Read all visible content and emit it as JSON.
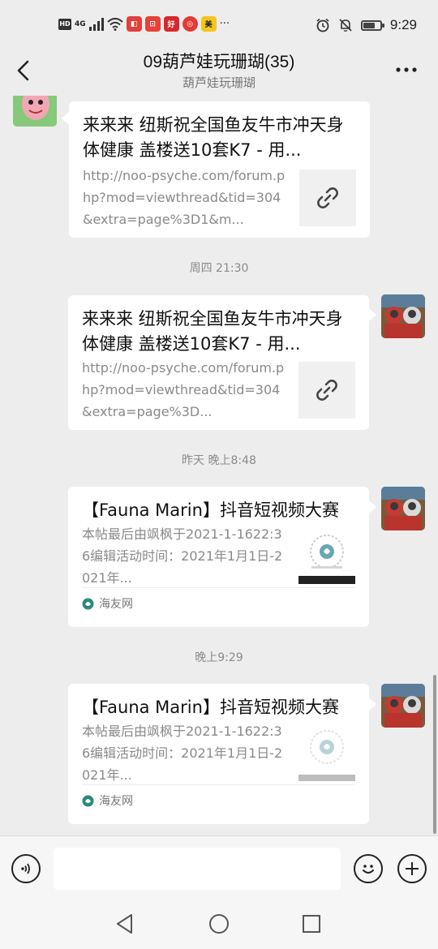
{
  "status_bar": {
    "network_type": "4G",
    "hd_label": "HD",
    "app_badge_1": "◧",
    "app_badge_2": "⊡",
    "app_badge_3": "好",
    "app_badge_4": "◎",
    "app_badge_5": "美",
    "overflow": "···",
    "time": "9:29",
    "battery_level": 0.7
  },
  "header": {
    "title": "09葫芦娃玩珊瑚(35)",
    "subtitle": "葫芦娃玩珊瑚"
  },
  "messages": [
    {
      "sender": "other",
      "title": "来来来 纽斯祝全国鱼友牛市冲天身体健康 盖楼送10套K7 - 用...",
      "description": "http://noo-psyche.com/forum.php?mod=viewthread&tid=304&extra=page%3D1&m...",
      "thumb_icon": "link-icon"
    },
    {
      "timestamp": "周四 21:30",
      "sender": "self",
      "title": "来来来 纽斯祝全国鱼友牛市冲天身体健康 盖楼送10套K7 - 用...",
      "description": "http://noo-psyche.com/forum.php?mod=viewthread&tid=304&extra=page%3D...",
      "thumb_icon": "link-icon"
    },
    {
      "timestamp": "昨天 晚上8:48",
      "sender": "self",
      "title": "【Fauna Marin】抖音短视频大赛",
      "description": "本帖最后由飒枫于2021-1-1622:36编辑活动时间：2021年1月1日-2021年...",
      "source": "海友网",
      "thumb_icon": "poster-thumbnail"
    },
    {
      "timestamp": "晚上9:29",
      "sender": "self",
      "title": "【Fauna Marin】抖音短视频大赛",
      "description": "本帖最后由飒枫于2021-1-1622:36编辑活动时间：2021年1月1日-2021年...",
      "source": "海友网",
      "thumb_icon": "poster-thumbnail"
    }
  ],
  "input": {
    "value": "",
    "placeholder": ""
  },
  "colors": {
    "background": "#ededed",
    "bubble": "#ffffff",
    "muted_text": "#8a8a8a",
    "source_icon": "#2a8a7a"
  }
}
